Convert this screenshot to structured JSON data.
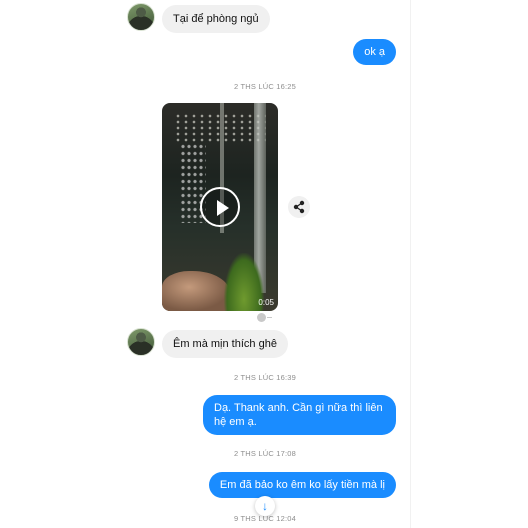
{
  "messages": {
    "m1": "Tại để phòng ngủ",
    "m2": "ok ạ",
    "m3": "Êm mà mịn thích ghê",
    "m4": "Dạ. Thank anh. Cần gì nữa thì liên hệ em ạ.",
    "m5": "Em đã bảo ko êm ko lấy tiền mà lị"
  },
  "timestamps": {
    "t1": "2 THS LÚC 16:25",
    "t2": "2 THS LÚC 16:39",
    "t3": "2 THS LÚC 17:08",
    "t4": "9 THS LÚC 12:04"
  },
  "video": {
    "duration": "0:05"
  },
  "icons": {
    "play": "play-icon",
    "share": "share-icon",
    "scroll": "arrow-down-icon",
    "seen": "seen-indicator-icon"
  },
  "colors": {
    "outgoing": "#1a8cff",
    "incoming": "#f0f0f0"
  }
}
